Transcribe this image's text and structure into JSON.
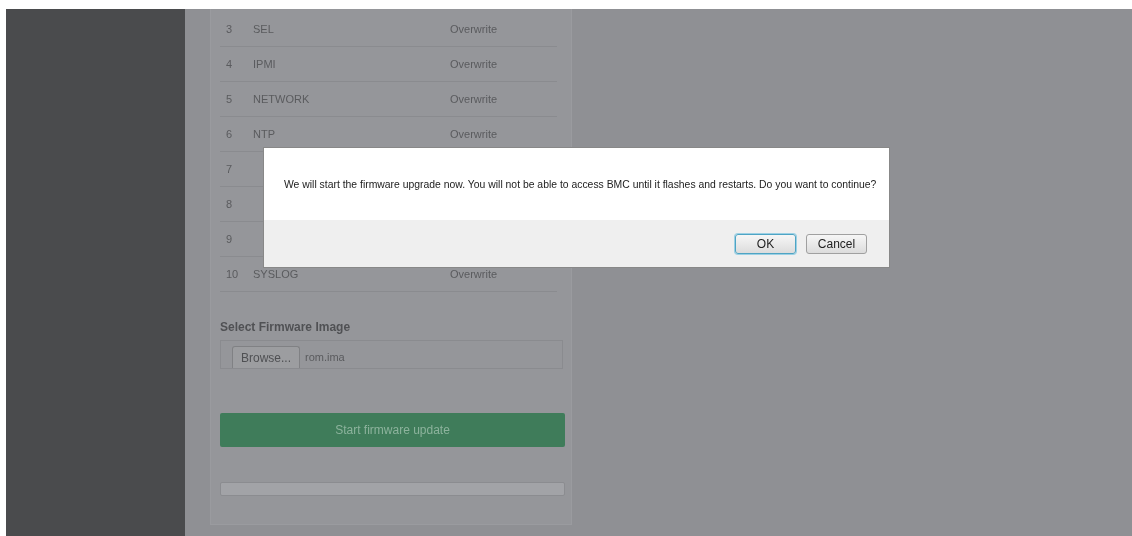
{
  "table": {
    "rows": [
      {
        "index": "3",
        "name": "SEL",
        "action": "Overwrite"
      },
      {
        "index": "4",
        "name": "IPMI",
        "action": "Overwrite"
      },
      {
        "index": "5",
        "name": "NETWORK",
        "action": "Overwrite"
      },
      {
        "index": "6",
        "name": "NTP",
        "action": "Overwrite"
      },
      {
        "index": "7"
      },
      {
        "index": "8"
      },
      {
        "index": "9"
      },
      {
        "index": "10",
        "name": "SYSLOG",
        "action": "Overwrite"
      }
    ]
  },
  "firmware": {
    "label": "Select Firmware Image",
    "browse_button": "Browse...",
    "file_name": "rom.ima",
    "start_button": "Start firmware update",
    "progress": {
      "level": 0
    }
  },
  "dialog": {
    "message": "We will start the firmware upgrade now. You will not be able to access BMC until it flashes and restarts. Do you want to continue?",
    "buttons": [
      {
        "label": "OK",
        "focused": true
      },
      {
        "label": "Cancel",
        "focused": false
      }
    ]
  }
}
